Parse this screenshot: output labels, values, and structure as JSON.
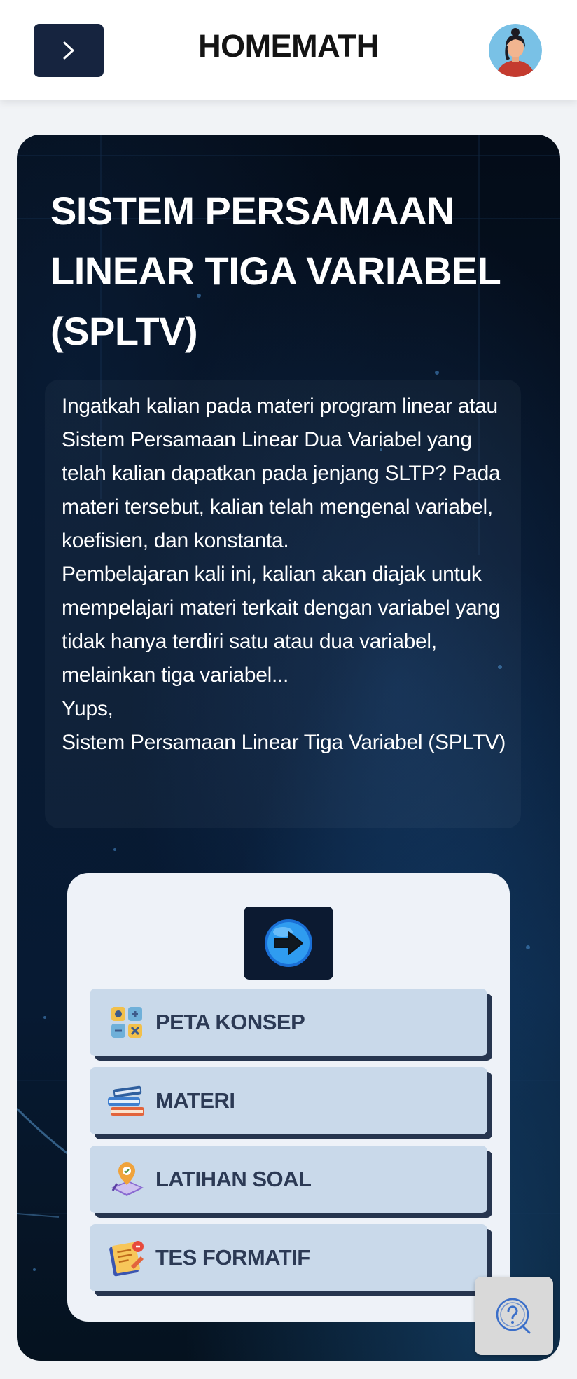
{
  "header": {
    "title": "HOMEMATH",
    "menu_icon": "chevron-right-icon",
    "avatar_icon": "user-avatar"
  },
  "hero": {
    "title_lines": [
      "SISTEM PERSAMAAN",
      "LINEAR TIGA VARIABEL",
      "(SPLTV)"
    ],
    "intro": {
      "paragraph1": "Ingatkah kalian pada materi program linear atau Sistem Persamaan Linear Dua Variabel yang telah kalian dapatkan pada jenjang SLTP? Pada materi tersebut, kalian telah mengenal variabel, koefisien, dan konstanta.",
      "paragraph2": "Pembelajaran kali ini, kalian akan diajak untuk mempelajari materi terkait dengan variabel yang tidak hanya terdiri satu atau dua variabel, melainkan tiga variabel...",
      "paragraph3": "Yups,",
      "paragraph4": "Sistem Persamaan Linear Tiga Variabel (SPLTV)"
    }
  },
  "panel": {
    "go_icon": "arrow-right-icon",
    "items": [
      {
        "label": "PETA KONSEP",
        "icon": "concept-map-icon"
      },
      {
        "label": "MATERI",
        "icon": "books-icon"
      },
      {
        "label": "LATIHAN SOAL",
        "icon": "exercise-icon"
      },
      {
        "label": "TES FORMATIF",
        "icon": "test-icon"
      }
    ]
  },
  "help": {
    "icon": "question-icon"
  },
  "colors": {
    "header_bg": "#ffffff",
    "menu_button": "#16243f",
    "hero_bg": "#061428",
    "panel_bg": "#eef2f8",
    "nav_item_bg": "#c9d9ea",
    "nav_item_shadow": "#26354f",
    "nav_text": "#2c3a55",
    "help_bg": "#d9d9d9",
    "help_icon": "#3b6fc9"
  }
}
